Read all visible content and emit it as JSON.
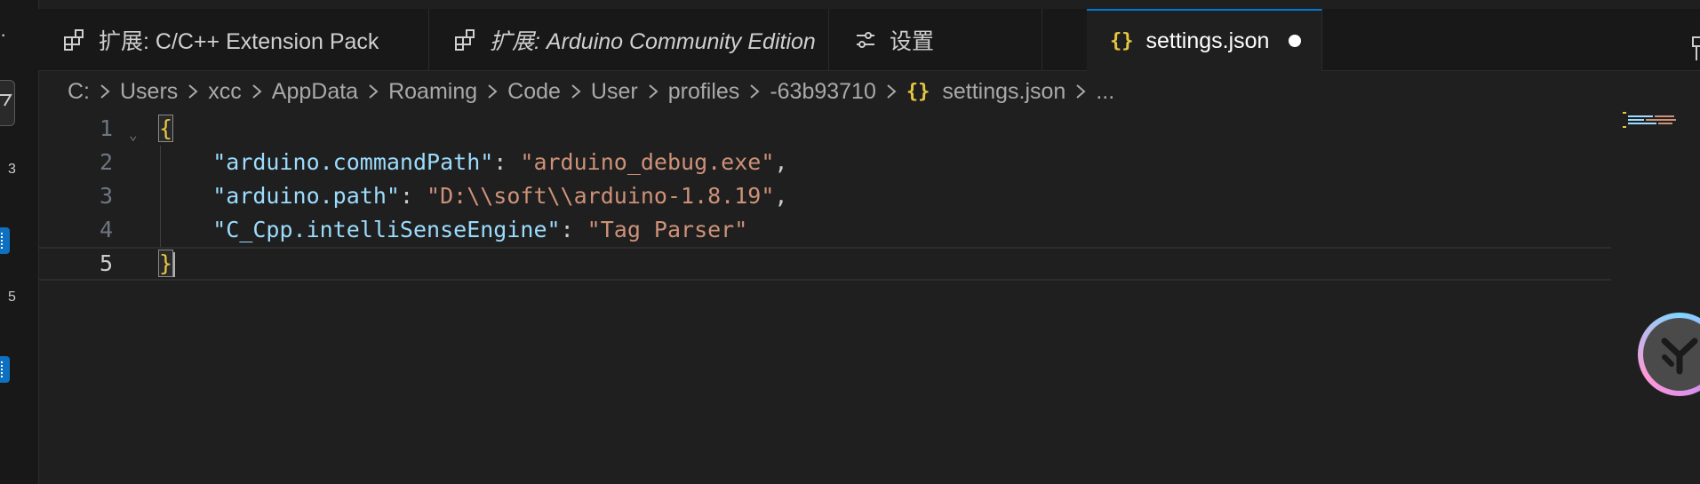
{
  "tabs": [
    {
      "label": "扩展: C/C++ Extension Pack",
      "icon": "extensions-icon",
      "italic": false
    },
    {
      "label": "扩展: Arduino Community Edition",
      "icon": "extensions-icon",
      "italic": true
    },
    {
      "label": "设置",
      "icon": "settings-sliders-icon",
      "italic": false
    },
    {
      "label": "settings.json",
      "icon": "json-braces-icon",
      "active": true,
      "dirty": true
    }
  ],
  "json_icon_glyph": "{}",
  "breadcrumb": [
    "C:",
    "Users",
    "xcc",
    "AppData",
    "Roaming",
    "Code",
    "User",
    "profiles",
    "-63b93710",
    "settings.json",
    "..."
  ],
  "activity": {
    "badge_3": "3",
    "badge_5": "5"
  },
  "editor": {
    "lines": [
      {
        "n": "1",
        "open": "{"
      },
      {
        "n": "2",
        "key": "\"arduino.commandPath\"",
        "value": "\"arduino_debug.exe\"",
        "comma": ","
      },
      {
        "n": "3",
        "key": "\"arduino.path\"",
        "value": "\"D:\\\\soft\\\\arduino-1.8.19\"",
        "comma": ","
      },
      {
        "n": "4",
        "key": "\"C_Cpp.intelliSenseEngine\"",
        "value": "\"Tag Parser\"",
        "comma": ""
      },
      {
        "n": "5",
        "close": "}"
      }
    ],
    "colon": ": "
  },
  "colors": {
    "accent": "#0078d4",
    "key": "#9cdcfe",
    "string": "#ce9178",
    "brace": "#e5c641",
    "background": "#1f1f1f"
  }
}
